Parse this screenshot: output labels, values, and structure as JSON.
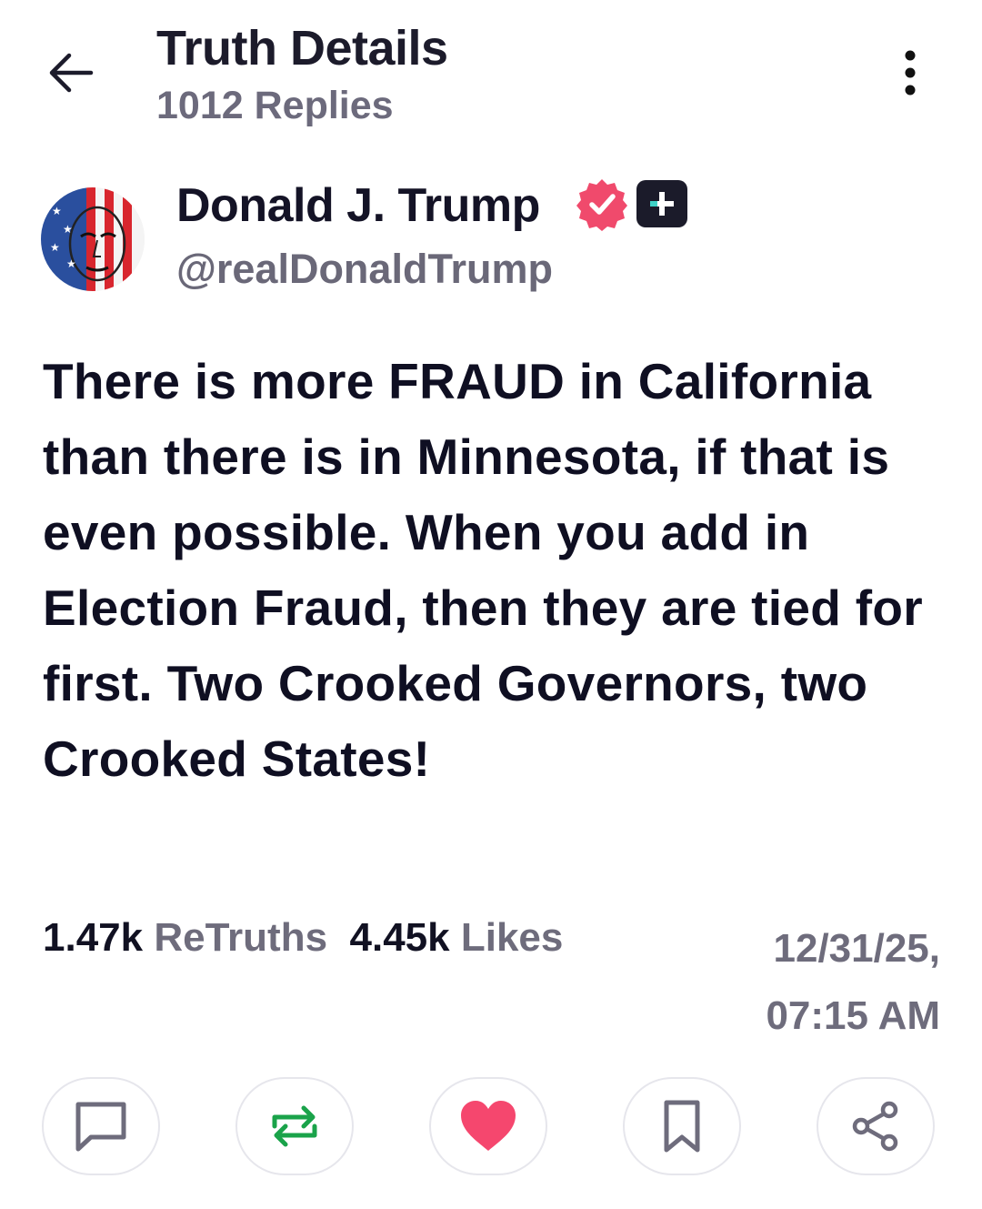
{
  "header": {
    "title": "Truth Details",
    "replies": "1012 Replies"
  },
  "author": {
    "display_name": "Donald J. Trump",
    "handle": "@realDonaldTrump",
    "verified_badge_color": "#f04a6c"
  },
  "post": {
    "text": "There is more FRAUD in California than there is in Minnesota, if that is even possible. When you add in Election Fraud, then they are tied for first. Two Crooked Governors, two Crooked States!"
  },
  "stats": {
    "retruths_count": "1.47k",
    "retruths_label": "ReTruths",
    "likes_count": "4.45k",
    "likes_label": "Likes"
  },
  "timestamp": {
    "date": "12/31/25,",
    "time": "07:15 AM"
  },
  "actions": [
    {
      "icon": "comment-icon"
    },
    {
      "icon": "retruth-icon",
      "color": "#1aa34a"
    },
    {
      "icon": "heart-icon",
      "color": "#f5476e"
    },
    {
      "icon": "bookmark-icon"
    },
    {
      "icon": "share-icon"
    }
  ],
  "colors": {
    "text_primary": "#0f0f22",
    "text_secondary": "#6e6c7c",
    "retruth_green": "#1aa34a",
    "like_red": "#f5476e"
  }
}
